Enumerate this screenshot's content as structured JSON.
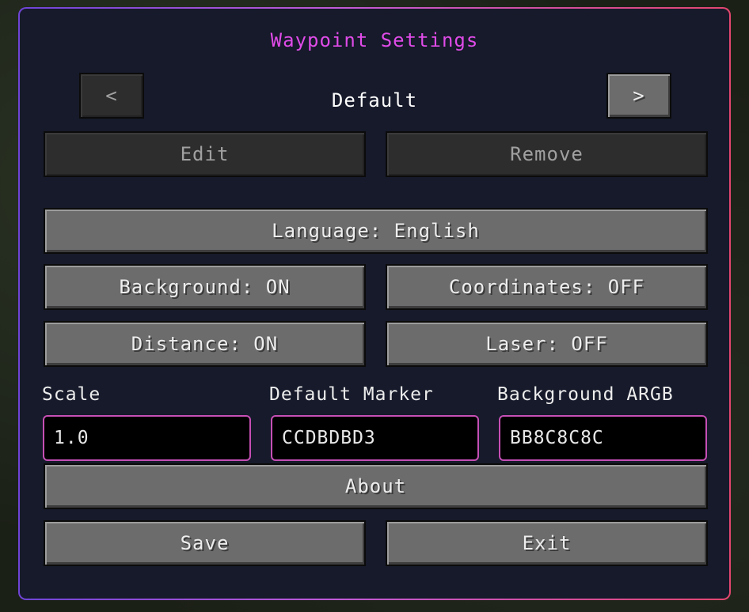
{
  "window": {
    "title": "Waypoint Settings"
  },
  "profile": {
    "prev_label": "<",
    "current": "Default",
    "next_label": ">"
  },
  "profile_actions": {
    "edit_label": "Edit",
    "remove_label": "Remove"
  },
  "options": {
    "language_label": "Language: English",
    "background_label": "Background: ON",
    "coordinates_label": "Coordinates: OFF",
    "distance_label": "Distance: ON",
    "laser_label": "Laser: OFF"
  },
  "fields": {
    "scale": {
      "label": "Scale",
      "value": "1.0"
    },
    "default_marker": {
      "label": "Default Marker",
      "value": "CCDBDBD3"
    },
    "background_argb": {
      "label": "Background ARGB",
      "value": "BB8C8C8C"
    }
  },
  "footer": {
    "about_label": "About",
    "save_label": "Save",
    "exit_label": "Exit"
  },
  "colors": {
    "title": "#e04be8",
    "border_left": "#6e44d6",
    "border_right": "#e2466f",
    "panel_bg": "#161a2a",
    "input_border": "#c64fb5"
  }
}
